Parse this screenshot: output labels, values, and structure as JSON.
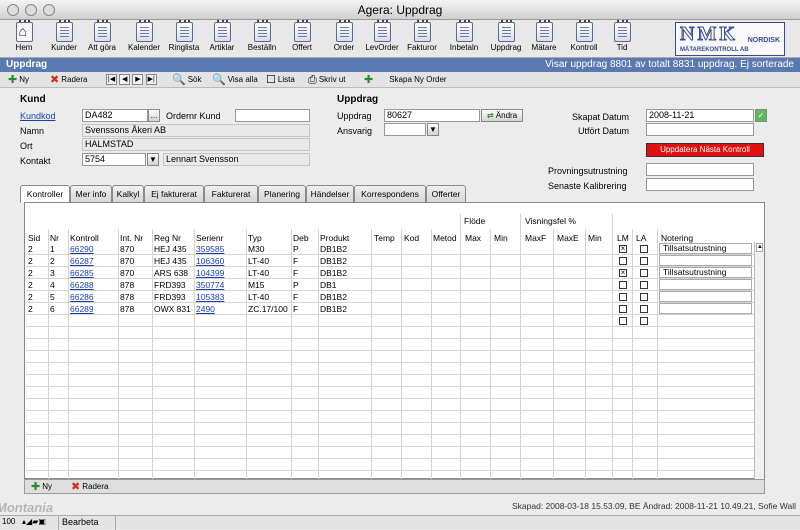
{
  "window": {
    "title": "Agera: Uppdrag"
  },
  "nav": [
    {
      "label": "Hem",
      "icon": "home-icon"
    },
    {
      "label": "Kunder",
      "icon": "document-icon"
    },
    {
      "label": "Att göra",
      "icon": "document-icon"
    },
    {
      "label": "Kalender",
      "icon": "document-icon"
    },
    {
      "label": "Ringlista",
      "icon": "document-icon"
    },
    {
      "label": "Artiklar",
      "icon": "document-icon"
    },
    {
      "label": "Beställn",
      "icon": "document-icon"
    },
    {
      "label": "Offert",
      "icon": "document-icon"
    },
    {
      "label": "Order",
      "icon": "document-icon"
    },
    {
      "label": "LevOrder",
      "icon": "document-icon"
    },
    {
      "label": "Fakturor",
      "icon": "document-icon"
    },
    {
      "label": "Inbetaln",
      "icon": "document-icon"
    },
    {
      "label": "Uppdrag",
      "icon": "document-icon"
    },
    {
      "label": "Mätare",
      "icon": "document-icon"
    },
    {
      "label": "Kontroll",
      "icon": "document-icon"
    },
    {
      "label": "Tid",
      "icon": "document-icon"
    }
  ],
  "logo": {
    "big": "NMK",
    "line1": "NORDISK",
    "line2": "MÄTAREKONTROLL AB"
  },
  "header": {
    "title": "Uppdrag",
    "record_info": "Visar uppdrag 8801 av totalt 8831 uppdrag. Ej sorterade"
  },
  "toolbar": {
    "new": "Ny",
    "delete": "Radera",
    "search": "Sök",
    "show_all": "Visa alla",
    "list": "Lista",
    "print": "Skriv ut",
    "create_order": "Skapa Ny Order"
  },
  "kund": {
    "section": "Kund",
    "kundkod_label": "Kundkod",
    "kundkod": "DA482",
    "ordernr_label": "Ordernr Kund",
    "ordernr": "",
    "namn_label": "Namn",
    "namn": "Svenssons Åkeri AB",
    "ort_label": "Ort",
    "ort": "HALMSTAD",
    "kontakt_label": "Kontakt",
    "kontakt_id": "5754",
    "kontakt_namn": "Lennart Svensson",
    "lookup": "..."
  },
  "uppdrag": {
    "section": "Uppdrag",
    "uppdrag_label": "Uppdrag",
    "uppdrag": "80627",
    "change_button": "Ändra",
    "ansvarig_label": "Ansvarig",
    "ansvarig": ""
  },
  "dates": {
    "skapat_label": "Skapat Datum",
    "skapat": "2008-11-21",
    "utfort_label": "Utfört Datum",
    "utfort": "",
    "update_button": "Uppdatera Nästa Kontroll",
    "provning_label": "Provningsutrustning",
    "provning": "",
    "kalibrering_label": "Senaste Kalibrering",
    "kalibrering": ""
  },
  "tabs": [
    "Kontroller",
    "Mer info",
    "Kalkyl",
    "Ej fakturerat",
    "Fakturerat",
    "Planering",
    "Händelser",
    "Korrespondens",
    "Offerter"
  ],
  "table": {
    "group_flode": "Flöde",
    "group_visning": "Visningsfel %",
    "columns": [
      "Sid",
      "Nr",
      "Kontroll",
      "Int. Nr",
      "Reg Nr",
      "Serienr",
      "Typ",
      "Deb",
      "Produkt",
      "Temp",
      "Kod",
      "Metod",
      "Max",
      "Min",
      "MaxF",
      "MaxE",
      "Min",
      "LM",
      "LA",
      "Notering"
    ],
    "rows": [
      {
        "sid": "2",
        "nr": "1",
        "kontroll": "66290",
        "intnr": "870",
        "regnr": "HEJ 435",
        "serienr": "359585",
        "typ": "M30",
        "deb": "P",
        "produkt": "DB1B2",
        "lm": true,
        "la": false,
        "notering": "Tillsatsutrustning"
      },
      {
        "sid": "2",
        "nr": "2",
        "kontroll": "66287",
        "intnr": "870",
        "regnr": "HEJ 435",
        "serienr": "106360",
        "typ": "LT-40",
        "deb": "F",
        "produkt": "DB1B2",
        "lm": false,
        "la": false,
        "notering": ""
      },
      {
        "sid": "2",
        "nr": "3",
        "kontroll": "66285",
        "intnr": "870",
        "regnr": "ARS 638",
        "serienr": "104399",
        "typ": "LT-40",
        "deb": "F",
        "produkt": "DB1B2",
        "lm": true,
        "la": false,
        "notering": "Tillsatsutrustning"
      },
      {
        "sid": "2",
        "nr": "4",
        "kontroll": "66288",
        "intnr": "878",
        "regnr": "FRD393",
        "serienr": "350774",
        "typ": "M15",
        "deb": "P",
        "produkt": "DB1",
        "lm": false,
        "la": false,
        "notering": ""
      },
      {
        "sid": "2",
        "nr": "5",
        "kontroll": "66286",
        "intnr": "878",
        "regnr": "FRD393",
        "serienr": "105383",
        "typ": "LT-40",
        "deb": "F",
        "produkt": "DB1B2",
        "lm": false,
        "la": false,
        "notering": ""
      },
      {
        "sid": "2",
        "nr": "6",
        "kontroll": "66289",
        "intnr": "878",
        "regnr": "OWX 831",
        "serienr": "2490",
        "typ": "ZC.17/100",
        "deb": "F",
        "produkt": "DB1B2",
        "lm": false,
        "la": false,
        "notering": ""
      }
    ]
  },
  "bottom": {
    "new": "Ny",
    "delete": "Radera"
  },
  "footer": {
    "audit": "Skapad: 2008-03-18 15.53.09, BE Ändrad: 2008-11-21 10.49.21, Sofie Wall",
    "brand": "Montania"
  },
  "status": {
    "zoom": "100",
    "mode": "Bearbeta"
  }
}
